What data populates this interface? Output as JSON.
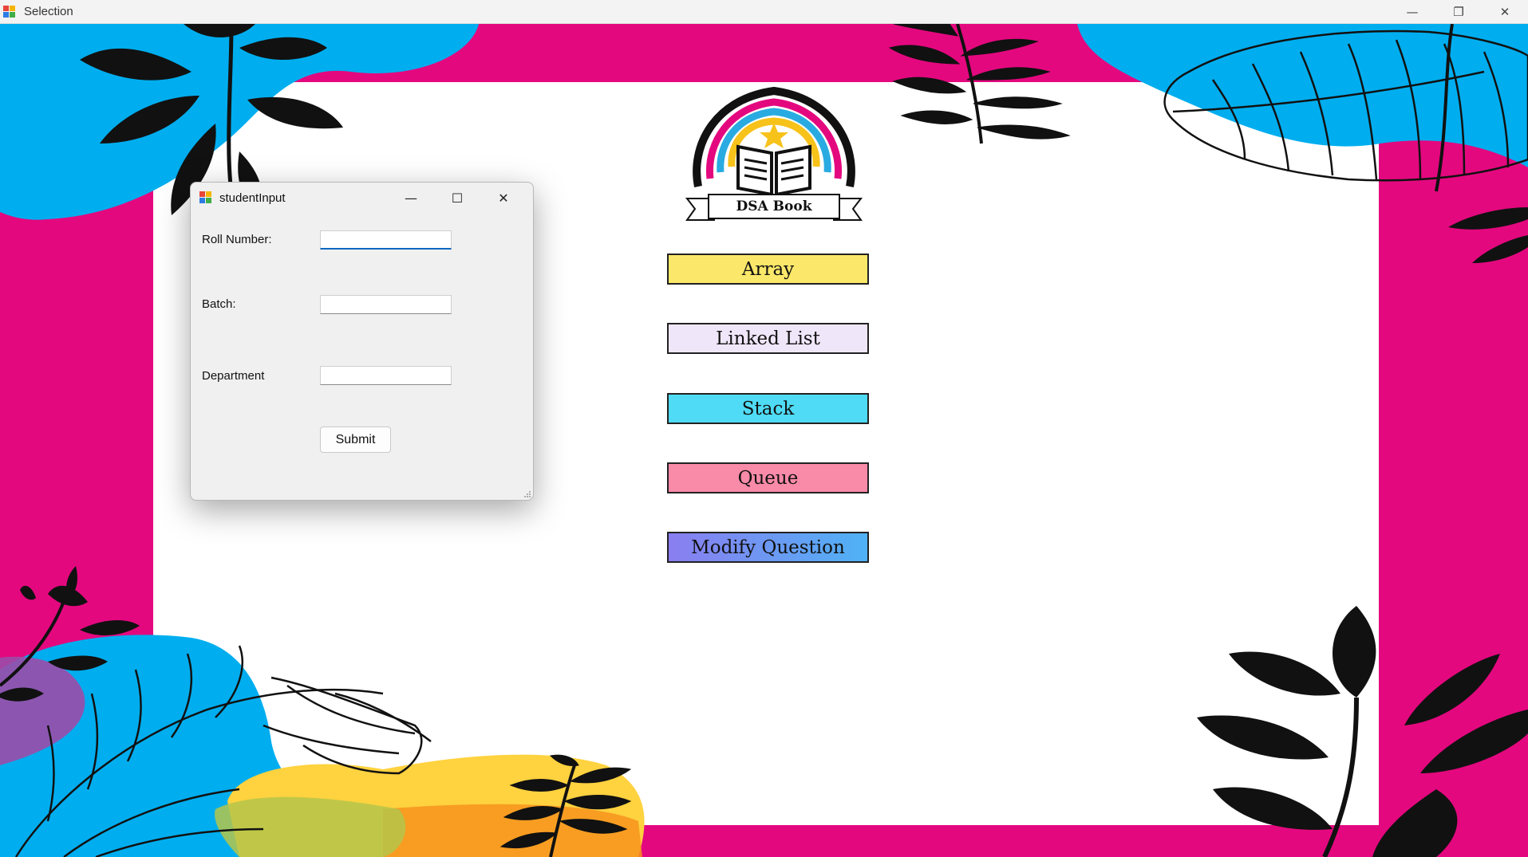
{
  "window": {
    "title": "Selection"
  },
  "logo": {
    "text": "DSA Book"
  },
  "menu": [
    {
      "label": "Array",
      "color": "#fbe86a"
    },
    {
      "label": "Linked List",
      "color": "#f0e6fa"
    },
    {
      "label": "Stack",
      "color": "#4fdbf5"
    },
    {
      "label": "Queue",
      "color": "#f98aa8"
    },
    {
      "label": "Modify Question",
      "color": "#8a8cf0"
    }
  ],
  "dialog": {
    "title": "studentInput",
    "fields": [
      {
        "label": "Roll Number:",
        "value": "",
        "placeholder": ""
      },
      {
        "label": "Batch:",
        "value": "",
        "placeholder": ""
      },
      {
        "label": "Department",
        "value": "",
        "placeholder": ""
      }
    ],
    "submit_label": "Submit"
  },
  "colors": {
    "border_pink": "#e4087f",
    "blue_blob": "#00aeef",
    "yellow_blob": "#ffd23f",
    "orange_blob": "#f7941d",
    "logo_yellow": "#f7c21a",
    "logo_blue": "#29abe2",
    "logo_pink": "#e4087f"
  },
  "icons": {
    "minimize": "minimize-icon",
    "restore": "restore-icon",
    "close": "close-icon",
    "maximize": "maximize-icon"
  }
}
